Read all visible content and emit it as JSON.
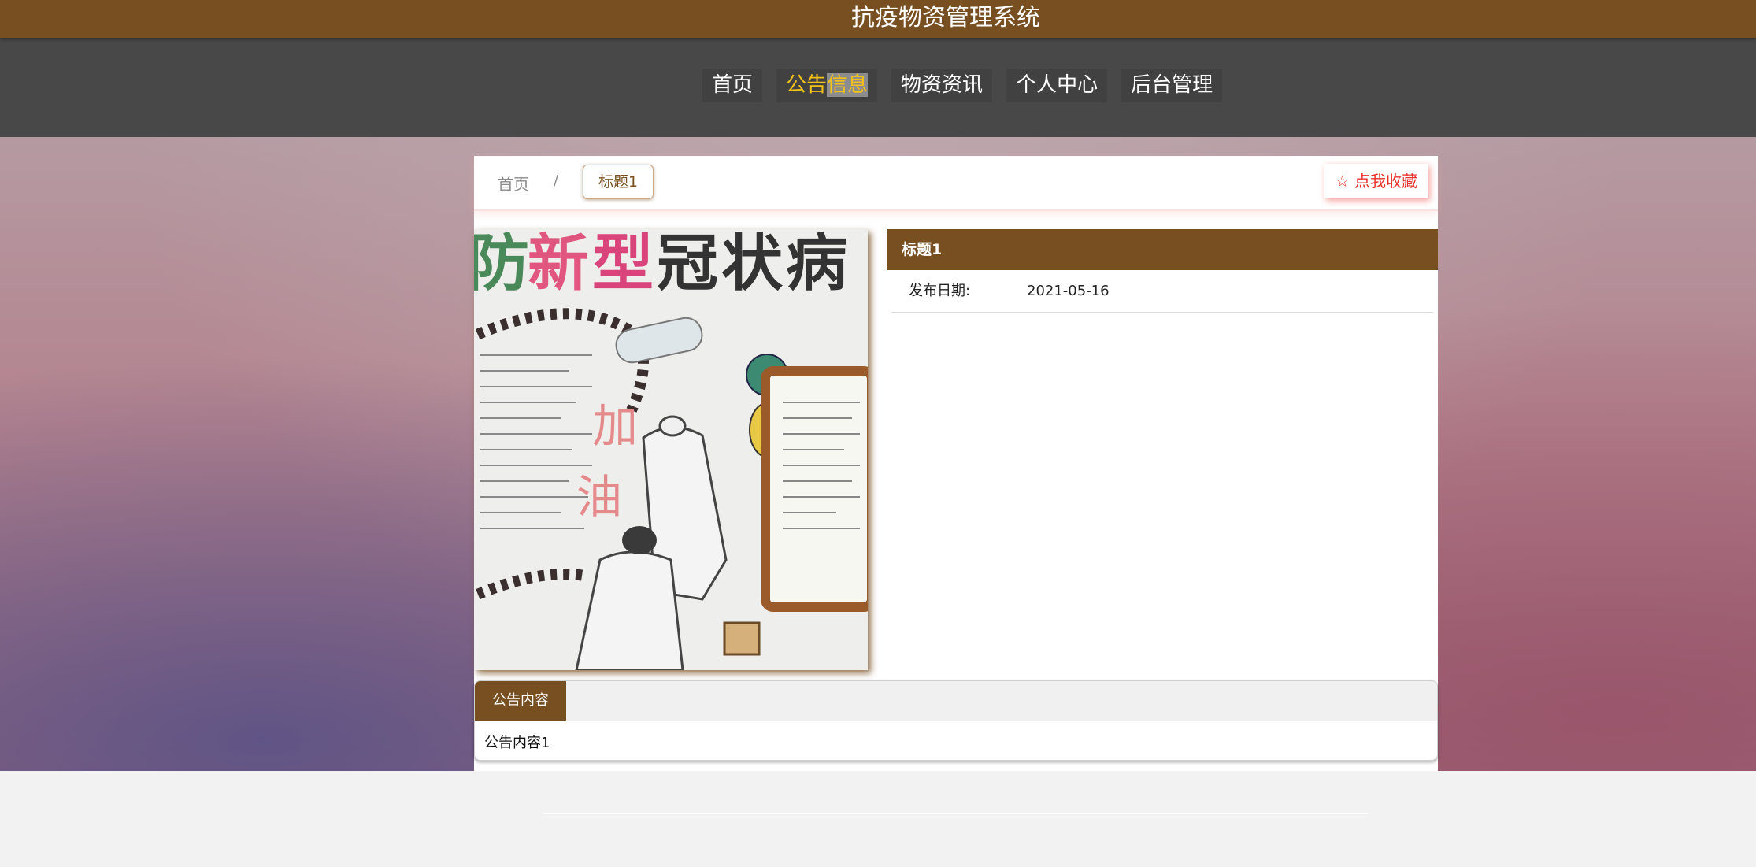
{
  "header": {
    "title": "抗疫物资管理系统",
    "brand_color": "#774f21"
  },
  "nav": {
    "items": [
      {
        "label": "首页"
      },
      {
        "label_part1": "公告",
        "label_part2": "信息",
        "active": true
      },
      {
        "label": "物资资讯"
      },
      {
        "label": "个人中心"
      },
      {
        "label": "后台管理"
      }
    ],
    "active_color": "#f3c11b"
  },
  "breadcrumb": {
    "home": "首页",
    "separator": "/",
    "current": "标题1"
  },
  "favorite": {
    "icon": "star-outline-icon",
    "label": "点我收藏",
    "color": "#e8302a"
  },
  "poster": {
    "heading_chars": [
      "防",
      "新",
      "型",
      "冠",
      "状",
      "病"
    ],
    "slogan_chars": [
      "加",
      "油"
    ]
  },
  "detail": {
    "title": "标题1",
    "date_label": "发布日期:",
    "date_value": "2021-05-16"
  },
  "content": {
    "tab_label": "公告内容",
    "body": "公告内容1"
  }
}
